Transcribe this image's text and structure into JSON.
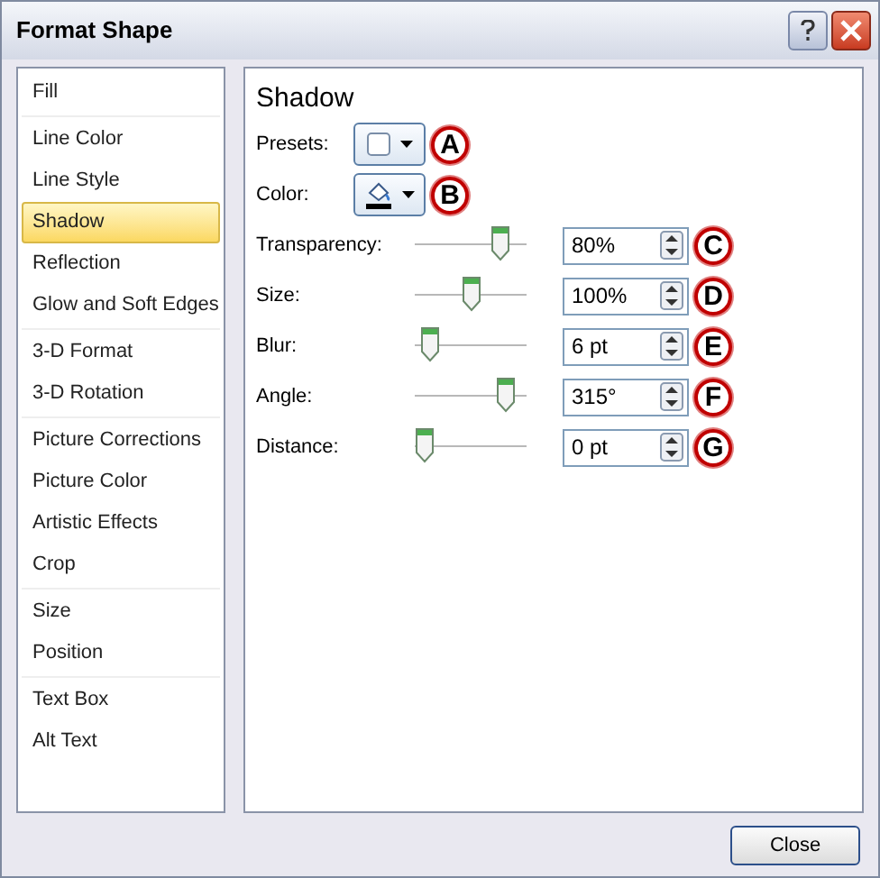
{
  "window": {
    "title": "Format Shape"
  },
  "sidebar": {
    "groups": [
      {
        "items": [
          {
            "label": "Fill",
            "selected": false
          }
        ]
      },
      {
        "items": [
          {
            "label": "Line Color",
            "selected": false
          },
          {
            "label": "Line Style",
            "selected": false
          },
          {
            "label": "Shadow",
            "selected": true
          },
          {
            "label": "Reflection",
            "selected": false
          },
          {
            "label": "Glow and Soft Edges",
            "selected": false
          }
        ]
      },
      {
        "items": [
          {
            "label": "3-D Format",
            "selected": false
          },
          {
            "label": "3-D Rotation",
            "selected": false
          }
        ]
      },
      {
        "items": [
          {
            "label": "Picture Corrections",
            "selected": false
          },
          {
            "label": "Picture Color",
            "selected": false
          },
          {
            "label": "Artistic Effects",
            "selected": false
          },
          {
            "label": "Crop",
            "selected": false
          }
        ]
      },
      {
        "items": [
          {
            "label": "Size",
            "selected": false
          },
          {
            "label": "Position",
            "selected": false
          }
        ]
      },
      {
        "items": [
          {
            "label": "Text Box",
            "selected": false
          },
          {
            "label": "Alt Text",
            "selected": false
          }
        ]
      }
    ]
  },
  "panel": {
    "heading": "Shadow",
    "rows": [
      {
        "kind": "presets",
        "label": "Presets:",
        "callout": "A"
      },
      {
        "kind": "color",
        "label": "Color:",
        "callout": "B"
      },
      {
        "kind": "slider",
        "label": "Transparency:",
        "level": 0.8,
        "value": "80%",
        "callout": "C"
      },
      {
        "kind": "slider",
        "label": "Size:",
        "level": 0.5,
        "value": "100%",
        "callout": "D"
      },
      {
        "kind": "slider",
        "label": "Blur:",
        "level": 0.06,
        "value": "6 pt",
        "callout": "E"
      },
      {
        "kind": "slider",
        "label": "Angle:",
        "level": 0.87,
        "value": "315°",
        "callout": "F"
      },
      {
        "kind": "slider",
        "label": "Distance:",
        "level": 0,
        "value": "0 pt",
        "callout": "G"
      }
    ]
  },
  "buttons": [
    "Close"
  ]
}
